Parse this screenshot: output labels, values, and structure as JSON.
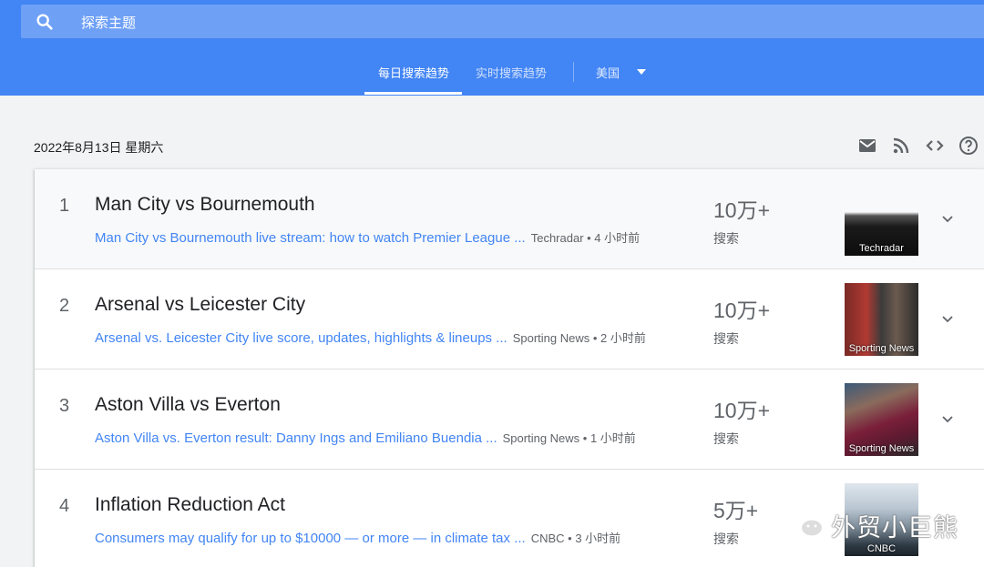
{
  "search": {
    "placeholder": "探索主题"
  },
  "tabs": [
    {
      "label": "每日搜索趋势",
      "active": true
    },
    {
      "label": "实时搜索趋势",
      "active": false
    }
  ],
  "region": {
    "label": "美国"
  },
  "date": "2022年8月13日 星期六",
  "toolbar": {
    "icons": [
      "email-icon",
      "rss-icon",
      "code-icon",
      "help-icon"
    ]
  },
  "trends": [
    {
      "rank": "1",
      "title": "Man City vs Bournemouth",
      "article": "Man City vs Bournemouth live stream: how to watch Premier League ...",
      "meta": "Techradar • 4 小时前",
      "count": "10万+",
      "count_label": "搜索",
      "thumb_caption": "Techradar"
    },
    {
      "rank": "2",
      "title": "Arsenal vs Leicester City",
      "article": "Arsenal vs. Leicester City live score, updates, highlights & lineups ...",
      "meta": "Sporting News • 2 小时前",
      "count": "10万+",
      "count_label": "搜索",
      "thumb_caption": "Sporting News"
    },
    {
      "rank": "3",
      "title": "Aston Villa vs Everton",
      "article": "Aston Villa vs. Everton result: Danny Ings and Emiliano Buendia ...",
      "meta": "Sporting News • 1 小时前",
      "count": "10万+",
      "count_label": "搜索",
      "thumb_caption": "Sporting News"
    },
    {
      "rank": "4",
      "title": "Inflation Reduction Act",
      "article": "Consumers may qualify for up to $10000 — or more — in climate tax ...",
      "meta": "CNBC • 3 小时前",
      "count": "5万+",
      "count_label": "搜索",
      "thumb_caption": "CNBC"
    }
  ],
  "watermark": {
    "text": "外贸小巨熊"
  },
  "colors": {
    "header": "#4285f4",
    "link": "#4285f4",
    "background": "#f1f3f4"
  }
}
